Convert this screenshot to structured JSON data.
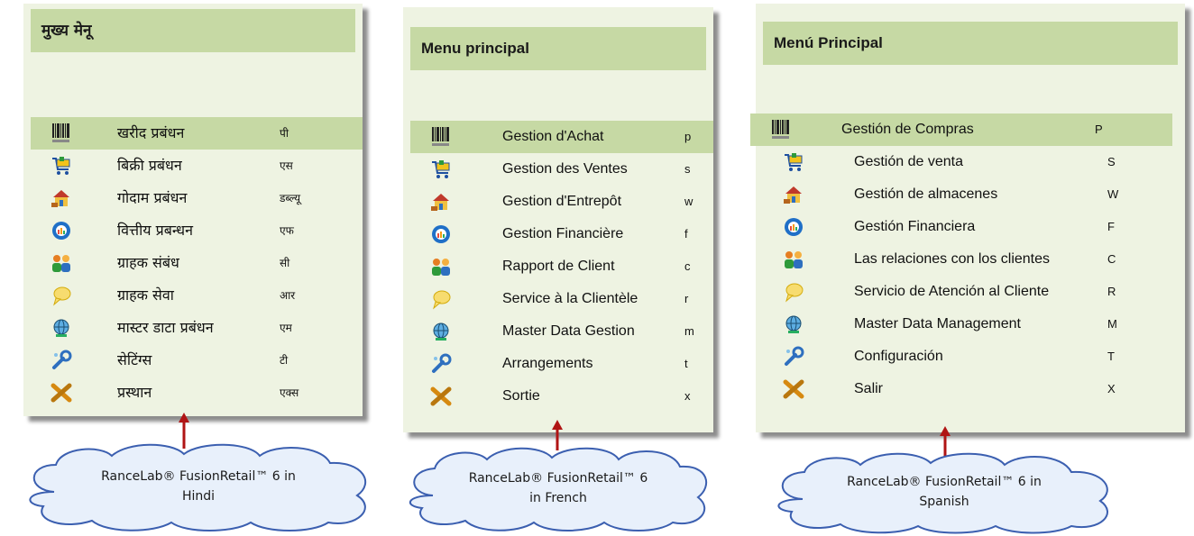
{
  "panels": [
    {
      "title": "मुख्य मेनू",
      "items": [
        {
          "icon": "barcode-icon",
          "label": "खरीद प्रबंधन",
          "key": "पी",
          "active": true
        },
        {
          "icon": "shopping-cart-icon",
          "label": "बिक्री प्रबंधन",
          "key": "एस",
          "active": false
        },
        {
          "icon": "warehouse-icon",
          "label": "गोदाम प्रबंधन",
          "key": "डब्ल्यू",
          "active": false
        },
        {
          "icon": "finance-chart-icon",
          "label": "वित्तीय प्रबन्धन",
          "key": "एफ",
          "active": false
        },
        {
          "icon": "customers-icon",
          "label": "ग्राहक संबंध",
          "key": "सी",
          "active": false
        },
        {
          "icon": "speech-bubble-icon",
          "label": "ग्राहक सेवा",
          "key": "आर",
          "active": false
        },
        {
          "icon": "globe-data-icon",
          "label": "मास्टर डाटा प्रबंधन",
          "key": "एम",
          "active": false
        },
        {
          "icon": "wrench-settings-icon",
          "label": "सेटिंग्स",
          "key": "टी",
          "active": false
        },
        {
          "icon": "exit-x-icon",
          "label": "प्रस्थान",
          "key": "एक्स",
          "active": false
        }
      ],
      "caption_line1": "RanceLab® FusionRetail™ 6 in",
      "caption_line2": "Hindi"
    },
    {
      "title": "Menu principal",
      "items": [
        {
          "icon": "barcode-icon",
          "label": "Gestion d'Achat",
          "key": "p",
          "active": true
        },
        {
          "icon": "shopping-cart-icon",
          "label": "Gestion des Ventes",
          "key": "s",
          "active": false
        },
        {
          "icon": "warehouse-icon",
          "label": "Gestion d'Entrepôt",
          "key": "w",
          "active": false
        },
        {
          "icon": "finance-chart-icon",
          "label": "Gestion Financière",
          "key": "f",
          "active": false
        },
        {
          "icon": "customers-icon",
          "label": "Rapport de Client",
          "key": "c",
          "active": false
        },
        {
          "icon": "speech-bubble-icon",
          "label": "Service à la Clientèle",
          "key": "r",
          "active": false
        },
        {
          "icon": "globe-data-icon",
          "label": "Master Data Gestion",
          "key": "m",
          "active": false
        },
        {
          "icon": "wrench-settings-icon",
          "label": "Arrangements",
          "key": "t",
          "active": false
        },
        {
          "icon": "exit-x-icon",
          "label": "Sortie",
          "key": "x",
          "active": false
        }
      ],
      "caption_line1": "RanceLab® FusionRetail™ 6",
      "caption_line2": "in French"
    },
    {
      "title": "Menú Principal",
      "items": [
        {
          "icon": "barcode-icon",
          "label": "Gestión de Compras",
          "key": "P",
          "active": true
        },
        {
          "icon": "shopping-cart-icon",
          "label": "Gestión de venta",
          "key": "S",
          "active": false
        },
        {
          "icon": "warehouse-icon",
          "label": "Gestión de almacenes",
          "key": "W",
          "active": false
        },
        {
          "icon": "finance-chart-icon",
          "label": "Gestión Financiera",
          "key": "F",
          "active": false
        },
        {
          "icon": "customers-icon",
          "label": "Las relaciones con los clientes",
          "key": "C",
          "active": false
        },
        {
          "icon": "speech-bubble-icon",
          "label": "Servicio de Atención al Cliente",
          "key": "R",
          "active": false
        },
        {
          "icon": "globe-data-icon",
          "label": "Master Data Management",
          "key": "M",
          "active": false
        },
        {
          "icon": "wrench-settings-icon",
          "label": "Configuración",
          "key": "T",
          "active": false
        },
        {
          "icon": "exit-x-icon",
          "label": "Salir",
          "key": "X",
          "active": false
        }
      ],
      "caption_line1": "RanceLab® FusionRetail™ 6 in",
      "caption_line2": "Spanish"
    }
  ],
  "colors": {
    "panel_bg": "#eef3e2",
    "header_bg": "#c6d9a4",
    "arrow": "#b01414",
    "cloud_fill": "#e8f0fb",
    "cloud_stroke": "#3b5fb0"
  }
}
